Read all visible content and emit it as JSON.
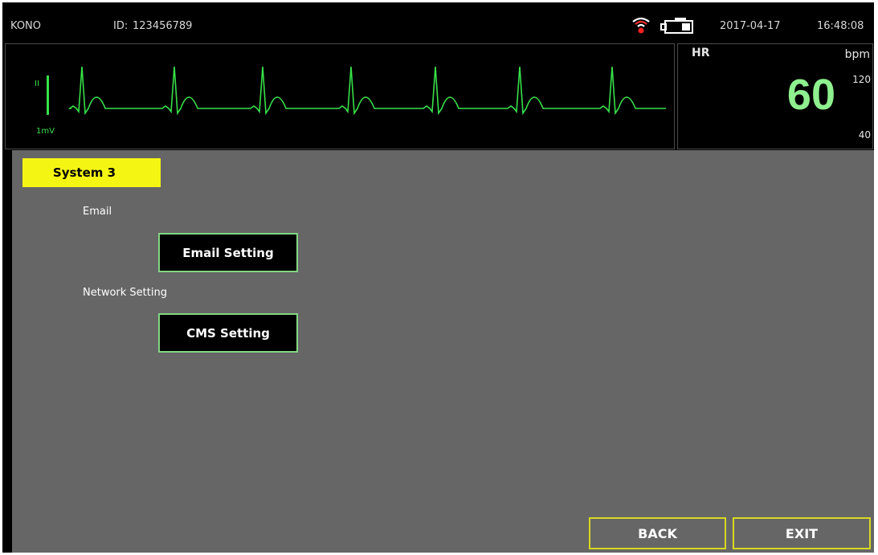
{
  "header": {
    "device_name": "KONO",
    "id_label": "ID:",
    "id_value": "123456789",
    "date": "2017-04-17",
    "time": "16:48:08",
    "icons": [
      "wifi-alarm-icon",
      "battery-icon"
    ]
  },
  "ecg": {
    "lead": "II",
    "scale": "1mV",
    "color": "#38e04a"
  },
  "hr": {
    "label": "HR",
    "unit": "bpm",
    "value": "60",
    "alarm_high": "120",
    "alarm_low": "40",
    "value_color": "#8ef08e"
  },
  "menu": {
    "title": "System 3",
    "title_color": "#f5f514",
    "sections": [
      {
        "label": "Email",
        "button": "Email Setting"
      },
      {
        "label": "Network Setting",
        "button": "CMS Setting"
      }
    ]
  },
  "footer": {
    "back_label": "BACK",
    "exit_label": "EXIT",
    "border_color": "#d8d820"
  }
}
